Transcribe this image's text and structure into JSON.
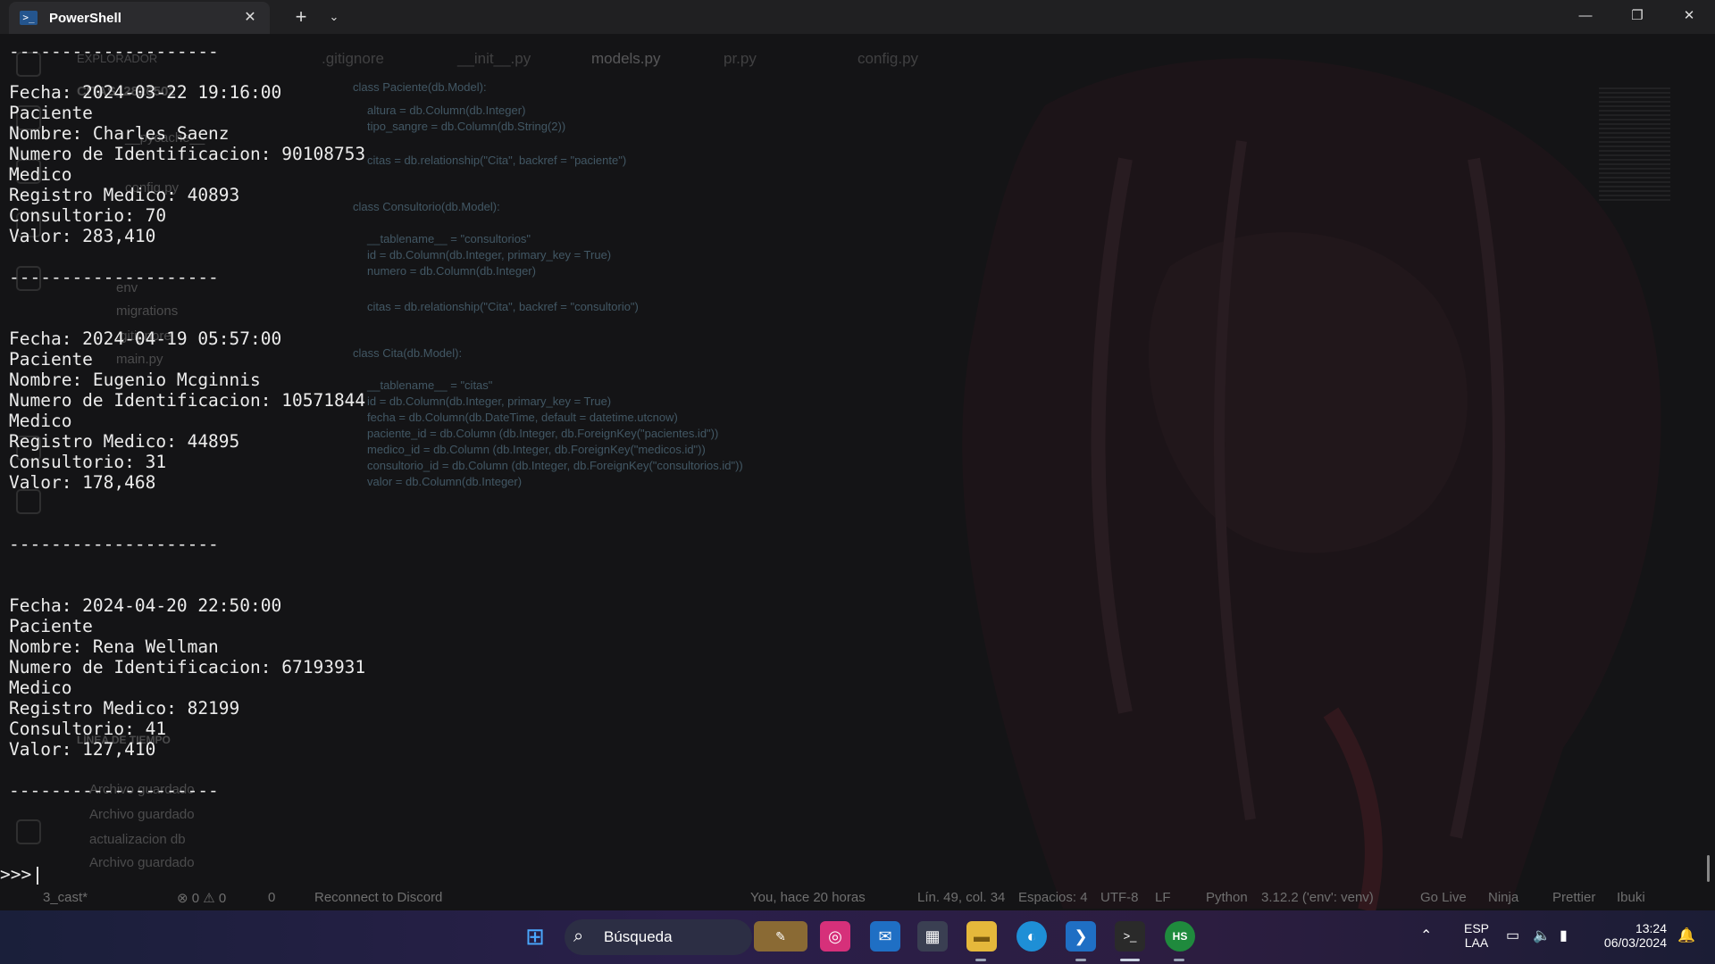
{
  "window": {
    "tab_title": "PowerShell",
    "tab_icon": "powershell-icon",
    "close_glyph": "✕",
    "new_tab_glyph": "+",
    "dropdown_glyph": "⌄",
    "minimize_glyph": "—",
    "maximize_glyph": "❐",
    "win_close_glyph": "✕"
  },
  "terminal": {
    "separator": "--------------------",
    "records": [
      {
        "fecha": "Fecha: 2024-03-22 19:16:00",
        "paciente": "Paciente",
        "nombre": "Nombre: Charles Saenz",
        "id": "Numero de Identificacion: 90108753",
        "medico": "Medico",
        "registro": "Registro Medico: 40893",
        "consultorio": "Consultorio: 70",
        "valor": "Valor: 283,410"
      },
      {
        "fecha": "Fecha: 2024-04-19 05:57:00",
        "paciente": "Paciente",
        "nombre": "Nombre: Eugenio Mcginnis",
        "id": "Numero de Identificacion: 10571844",
        "medico": "Medico",
        "registro": "Registro Medico: 44895",
        "consultorio": "Consultorio: 31",
        "valor": "Valor: 178,468"
      },
      {
        "fecha": "Fecha: 2024-04-20 22:50:00",
        "paciente": "Paciente",
        "nombre": "Nombre: Rena Wellman",
        "id": "Numero de Identificacion: 67193931",
        "medico": "Medico",
        "registro": "Registro Medico: 82199",
        "consultorio": "Consultorio: 41",
        "valor": "Valor: 127,410"
      }
    ],
    "prompt": ">>>"
  },
  "ghost_vscode": {
    "explorer_title": "EXPLORADOR",
    "project": "CITAS_2826502",
    "files": [
      "__pycache__",
      "config.py",
      "env",
      "migrations",
      ".gitignore",
      "main.py",
      "LÍNEA DE TIEMPO",
      "Archivo guardado",
      "Archivo guardado",
      "actualizacion db",
      "Archivo guardado"
    ],
    "tabs": [
      ".gitignore",
      "__init__.py",
      "models.py",
      "pr.py",
      "config.py"
    ],
    "code": [
      "class Paciente(db.Model):",
      "altura = db.Column(db.Integer)",
      "tipo_sangre = db.Column(db.String(2))",
      "citas = db.relationship(\"Cita\", backref = \"paciente\")",
      "class Consultorio(db.Model):",
      "__tablename__ = \"consultorios\"",
      "id = db.Column(db.Integer, primary_key = True)",
      "numero = db.Column(db.Integer)",
      "citas = db.relationship(\"Cita\", backref = \"consultorio\")",
      "class Cita(db.Model):",
      "__tablename__ = \"citas\"",
      "id = db.Column(db.Integer, primary_key = True)",
      "fecha = db.Column(db.DateTime, default = datetime.utcnow)",
      "paciente_id = db.Column (db.Integer, db.ForeignKey(\"pacientes.id\"))",
      "medico_id = db.Column (db.Integer, db.ForeignKey(\"medicos.id\"))",
      "consultorio_id = db.Column (db.Integer, db.ForeignKey(\"consultorios.id\"))",
      "valor = db.Column(db.Integer)"
    ],
    "status": {
      "branch": "3_cast*",
      "errors": "⊗ 0 ⚠ 0",
      "ports": "0",
      "discord": "Reconnect to Discord",
      "blame": "You, hace 20 horas",
      "cursor": "Lín. 49, col. 34",
      "spaces": "Espacios: 4",
      "encoding": "UTF-8",
      "eol": "LF",
      "language": "Python",
      "interpreter": "3.12.2 ('env': venv)",
      "golive": "Go Live",
      "ninja": "Ninja",
      "prettier": "Prettier",
      "ibuki": "Ibuki"
    }
  },
  "taskbar": {
    "search_label": "Búsqueda",
    "lang_top": "ESP",
    "lang_bottom": "LAA",
    "time": "13:24",
    "date": "06/03/2024"
  }
}
